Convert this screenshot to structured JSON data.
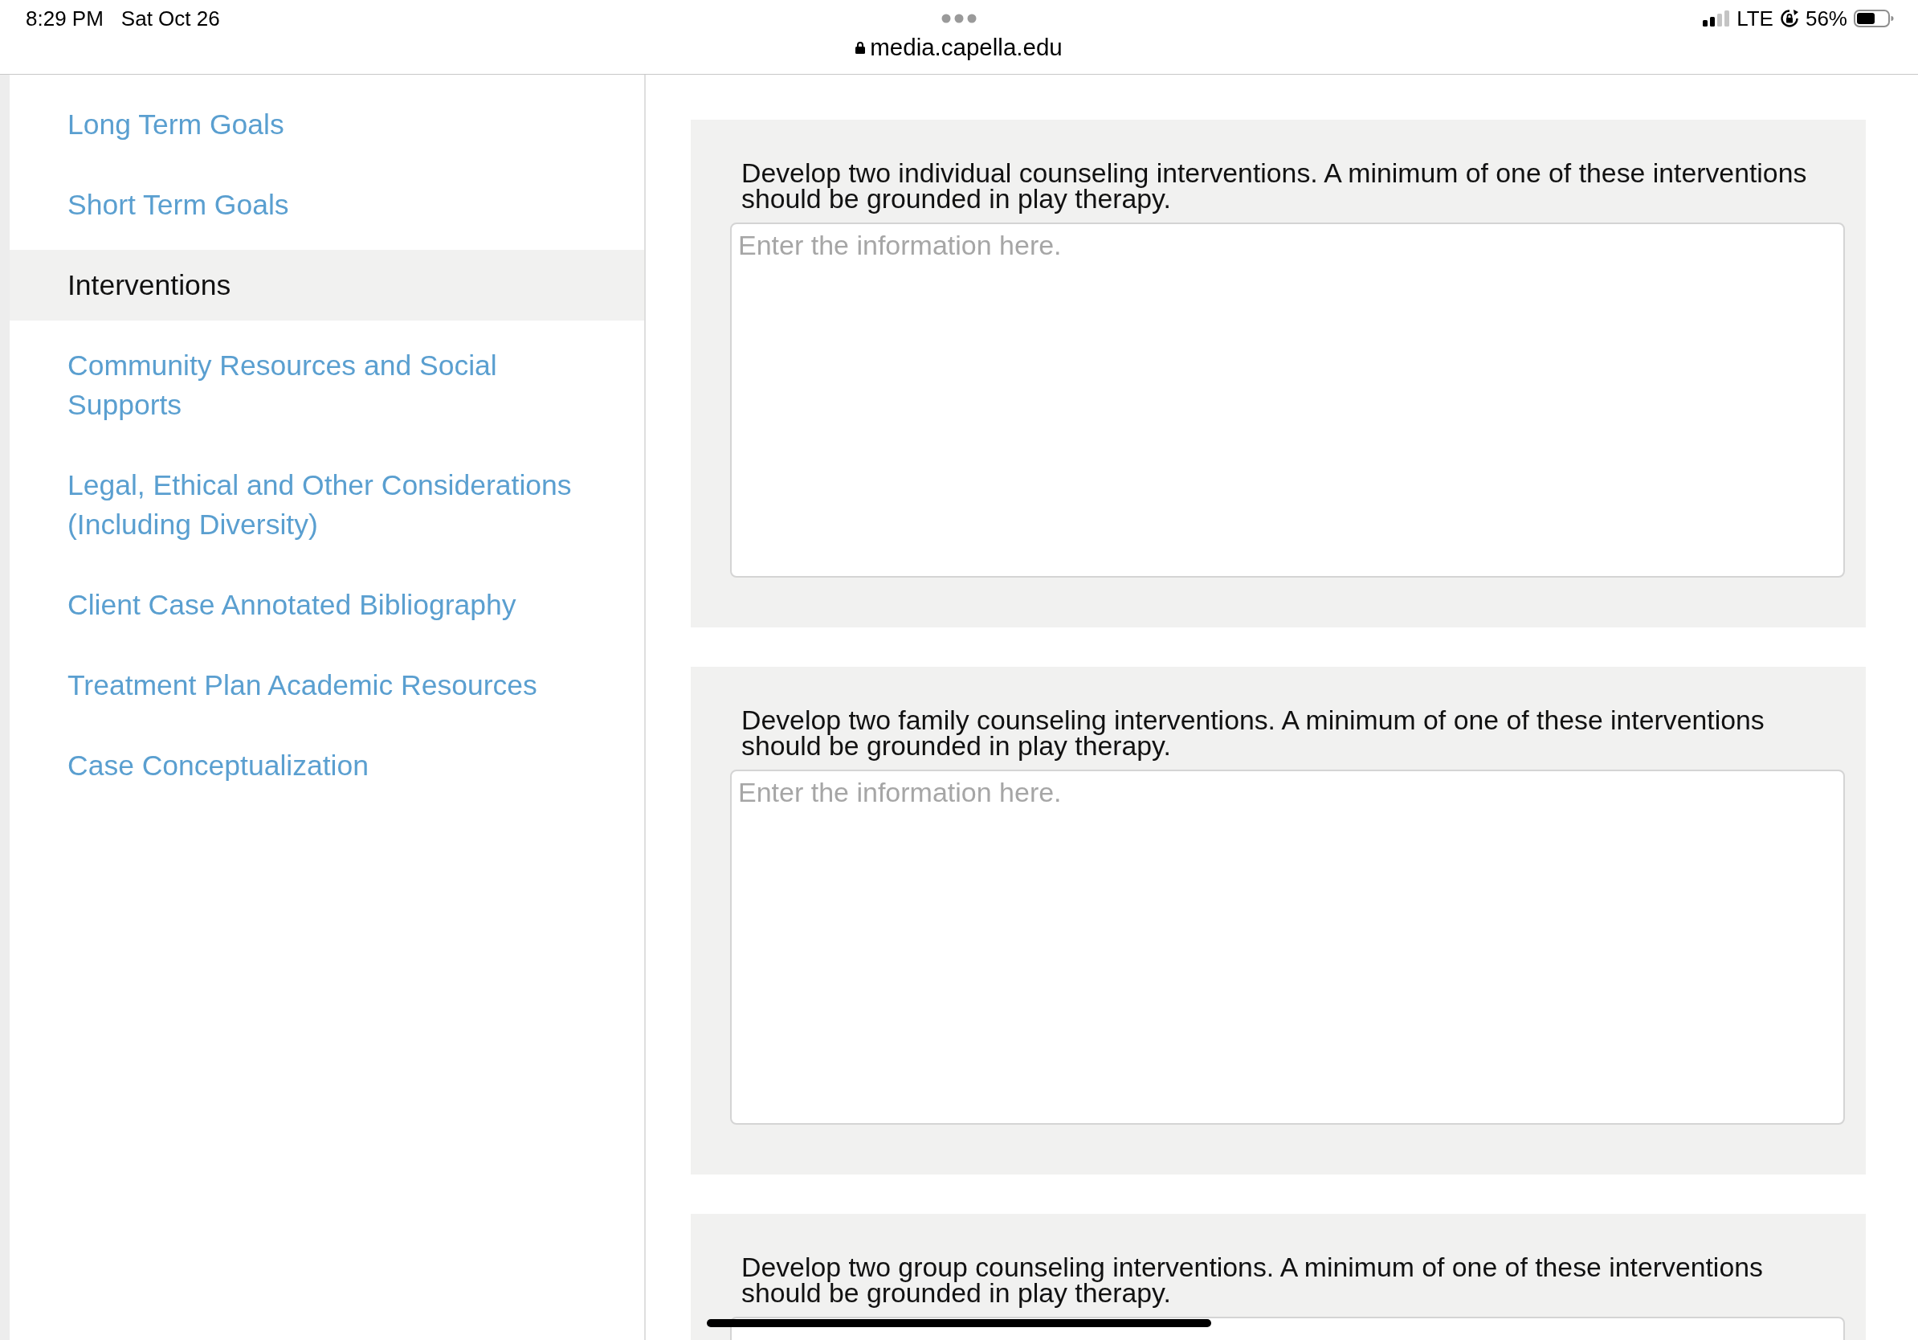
{
  "status_bar": {
    "time": "8:29 PM",
    "date": "Sat Oct 26",
    "network": "LTE",
    "battery": "56%"
  },
  "address_bar": {
    "url": "media.capella.edu"
  },
  "sidebar": {
    "items": [
      {
        "label": "Long Term Goals",
        "selected": false
      },
      {
        "label": "Short Term Goals",
        "selected": false
      },
      {
        "label": "Interventions",
        "selected": true
      },
      {
        "label": "Community Resources and Social Supports",
        "selected": false
      },
      {
        "label": "Legal, Ethical and Other Considerations (Including Diversity)",
        "selected": false
      },
      {
        "label": "Client Case Annotated Bibliography",
        "selected": false
      },
      {
        "label": "Treatment Plan Academic Resources",
        "selected": false
      },
      {
        "label": "Case Conceptualization",
        "selected": false
      }
    ]
  },
  "sections": [
    {
      "prompt": "Develop two individual counseling interventions. A minimum of one of these interventions should be grounded in play therapy.",
      "placeholder": "Enter the information here."
    },
    {
      "prompt": "Develop two family counseling interventions. A minimum of one of these interventions should be grounded in play therapy.",
      "placeholder": "Enter the information here."
    },
    {
      "prompt": "Develop two group counseling interventions. A minimum of one of these interventions should be grounded in play therapy."
    }
  ]
}
